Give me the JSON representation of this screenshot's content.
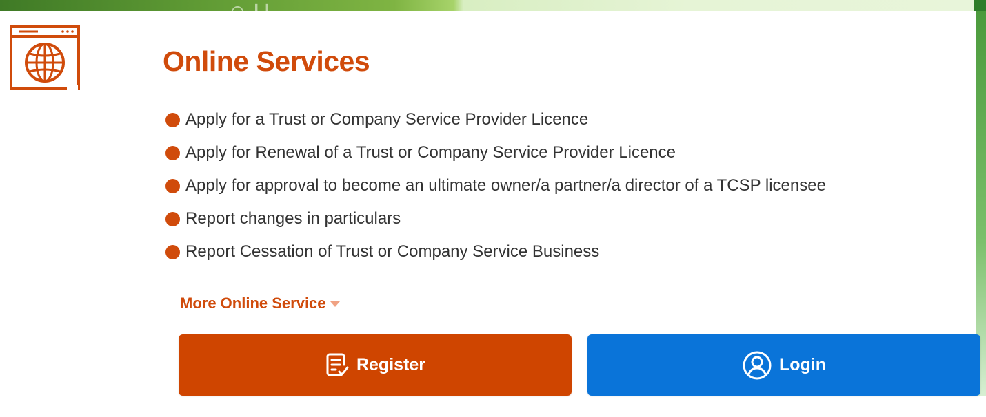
{
  "section": {
    "title": "Online Services",
    "icon": "globe-browser-icon"
  },
  "services": [
    {
      "label": "Apply for a Trust or Company Service Provider Licence"
    },
    {
      "label": "Apply for Renewal of a Trust or Company Service Provider Licence"
    },
    {
      "label": "Apply for approval to become an ultimate owner/a partner/a director of a TCSP licensee"
    },
    {
      "label": "Report changes in particulars"
    },
    {
      "label": "Report Cessation of Trust or Company Service Business"
    }
  ],
  "more_link": {
    "label": "More Online Service",
    "icon": "caret-down-icon"
  },
  "buttons": {
    "register": {
      "label": "Register",
      "icon": "register-form-icon",
      "color": "#cf4500"
    },
    "login": {
      "label": "Login",
      "icon": "user-circle-icon",
      "color": "#0a74d9"
    }
  },
  "colors": {
    "accent": "#d04b0b",
    "text": "#333333"
  }
}
